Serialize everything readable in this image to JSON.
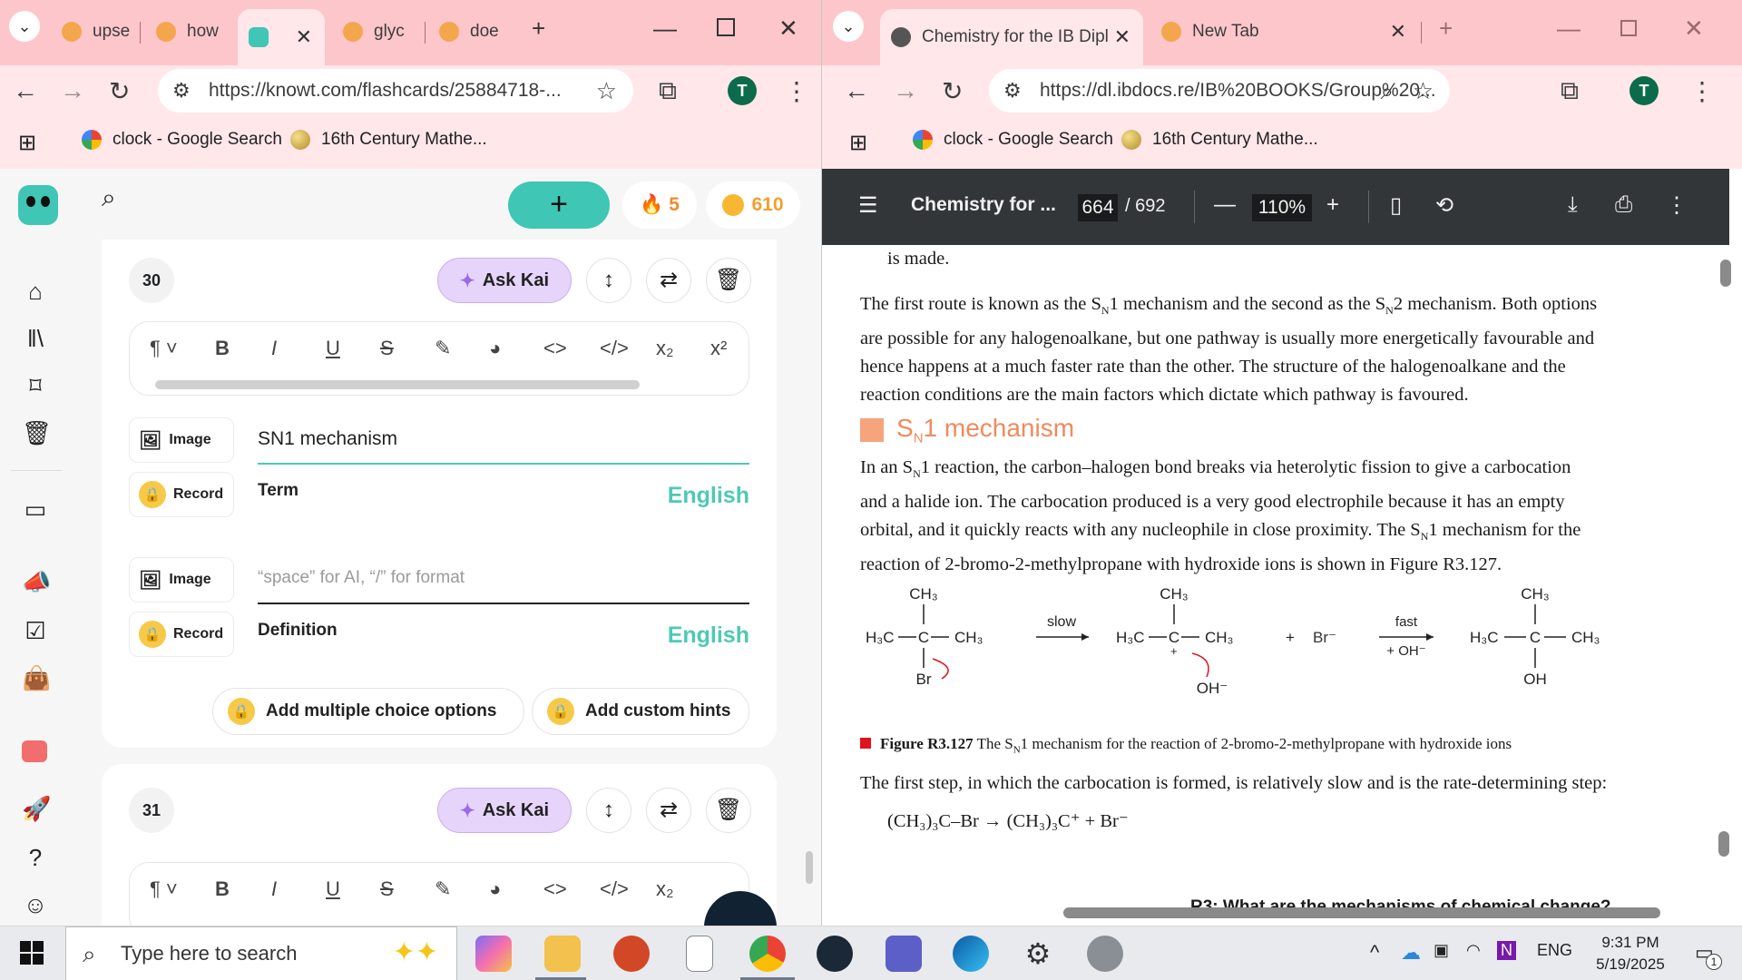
{
  "left_window": {
    "tabs": [
      {
        "title": "upse"
      },
      {
        "title": "how"
      },
      {
        "title": ""
      },
      {
        "title": "glyc"
      },
      {
        "title": "doe"
      }
    ],
    "url": "https://knowt.com/flashcards/25884718-...",
    "bookmarks": [
      "clock - Google Search",
      "16th Century Mathe..."
    ],
    "avatar": "T"
  },
  "right_window": {
    "tabs": [
      {
        "title": "Chemistry for the IB Dipl"
      },
      {
        "title": "New Tab"
      }
    ],
    "url": "https://dl.ibdocs.re/IB%20BOOKS/Group%20...",
    "bookmarks": [
      "clock - Google Search",
      "16th Century Mathe..."
    ],
    "avatar": "T"
  },
  "knowt": {
    "streak": "5",
    "coins": "610",
    "card30": {
      "number": "30",
      "ask_kai": "Ask Kai",
      "image_label": "Image",
      "record_label": "Record",
      "term_value": "SN1 mechanism",
      "term_label": "Term",
      "term_lang": "English",
      "definition_placeholder": "“space” for AI, “/” for format",
      "definition_label": "Definition",
      "definition_lang": "English",
      "add_mc": "Add multiple choice options",
      "add_hints": "Add custom hints"
    },
    "card31": {
      "number": "31",
      "ask_kai": "Ask Kai"
    }
  },
  "pdf": {
    "title": "Chemistry for ...",
    "page": "664",
    "total": "/ 692",
    "zoom": "110%",
    "line0": "is made.",
    "para1": [
      [
        "The first route is known as the S",
        "N",
        "1 mechanism and the second as the S",
        "N",
        "2 mechanism. Both options"
      ],
      [
        "are possible for any halogenoalkane, but one pathway is usually more energetically favourable and"
      ],
      [
        "hence happens at a much faster rate than the other. The structure of the halogenoalkane and the"
      ],
      [
        "reaction conditions are the main factors which dictate which pathway is favoured."
      ]
    ],
    "heading_s": "S",
    "heading_n": "N",
    "heading_rest": "1 mechanism",
    "para2": [
      [
        "In an S",
        "N",
        "1 reaction, the carbon–halogen bond breaks via heterolytic fission to give a carbocation"
      ],
      [
        "and a halide ion. The carbocation produced is a very good electrophile because it has an empty"
      ],
      [
        "orbital, and it quickly reacts with any nucleophile in close proximity. The S",
        "N",
        "1 mechanism for the"
      ],
      [
        "reaction of 2-bromo-2-methylpropane with hydroxide ions is shown in Figure R3.127."
      ]
    ],
    "figure": {
      "ch3": "CH₃",
      "h3c": "H₃C",
      "c": "C",
      "br": "Br",
      "br_ion": "Br⁻",
      "oh_ion": "OH⁻",
      "oh": "OH",
      "slow": "slow",
      "fast": "fast",
      "plus_oh": "+ OH⁻",
      "plus": "+"
    },
    "caption_bold": "Figure R3.127",
    "caption_a": " The S",
    "caption_n": "N",
    "caption_b": "1 mechanism for the reaction of 2-bromo-2-methylpropane with hydroxide ions",
    "para3": "The first step, in which the carbocation is formed, is relatively slow and is the rate-determining step:",
    "equation": "(CH₃)₃C–Br → (CH₃)₃C⁺ + Br⁻",
    "footer_cut": "R3: What are the mechanisms of chemical change?"
  },
  "taskbar": {
    "search_placeholder": "Type here to search",
    "lang": "ENG",
    "time": "9:31 PM",
    "date": "5/19/2025",
    "notif": "1"
  },
  "colors": {
    "chrome_pink": "#fdc6cb",
    "knowt_teal": "#3fc6b4",
    "pdf_toolbar": "#323639",
    "heading_orange": "#f08a5d"
  }
}
